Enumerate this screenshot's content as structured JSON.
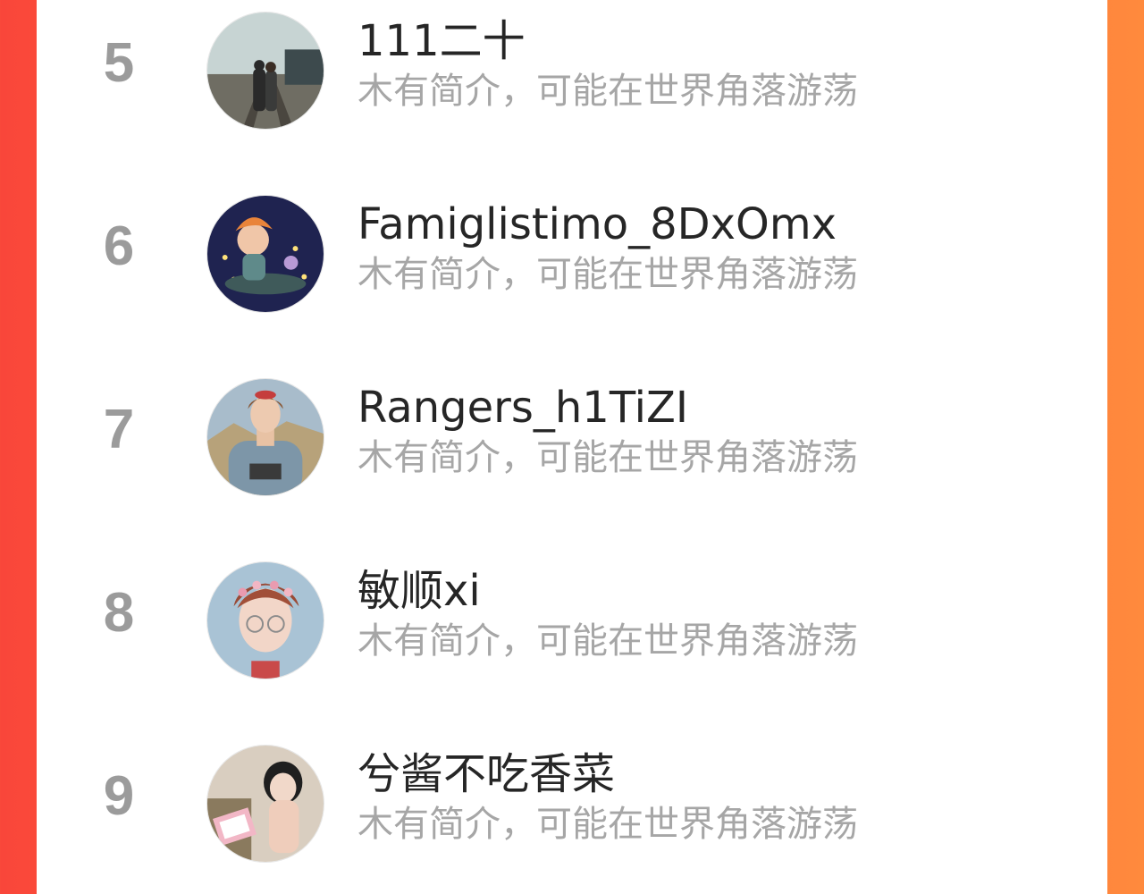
{
  "colors": {
    "background_left": "#f9463a",
    "background_right": "#ff8a3d",
    "panel": "#ffffff",
    "rank_text": "#9b9b9b",
    "name_text": "#262626",
    "intro_text": "#a6a6a6"
  },
  "ranking": {
    "items": [
      {
        "rank": "5",
        "name": "111二十",
        "intro": "木有简介，可能在世界角落游荡",
        "avatar_icon": "couple-on-railway-avatar"
      },
      {
        "rank": "6",
        "name": "Famiglistimo_8DxOmx",
        "intro": "木有简介，可能在世界角落游荡",
        "avatar_icon": "cartoon-night-avatar"
      },
      {
        "rank": "7",
        "name": "Rangers_h1TiZI",
        "intro": "木有简介，可能在世界角落游荡",
        "avatar_icon": "woman-denim-avatar"
      },
      {
        "rank": "8",
        "name": "敏顺xi",
        "intro": "木有简介，可能在世界角落游荡",
        "avatar_icon": "man-flower-crown-avatar"
      },
      {
        "rank": "9",
        "name": "兮酱不吃香菜",
        "intro": "木有简介，可能在世界角落游荡",
        "avatar_icon": "girl-reading-avatar"
      }
    ]
  }
}
